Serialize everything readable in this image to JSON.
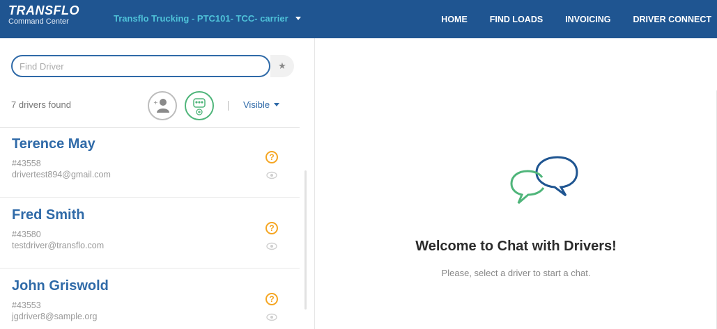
{
  "header": {
    "brand_name": "TRANSFLO",
    "brand_sub": "Command Center",
    "account_label": "Transflo Trucking - PTC101- TCC- carrier",
    "nav": [
      "HOME",
      "FIND LOADS",
      "INVOICING",
      "DRIVER CONNECT"
    ]
  },
  "search": {
    "placeholder": "Find Driver",
    "value": ""
  },
  "filters": {
    "count_text": "7 drivers found",
    "visibility_label": "Visible"
  },
  "drivers": [
    {
      "name": "Terence May",
      "id": "#43558",
      "email": "drivertest894@gmail.com"
    },
    {
      "name": "Fred Smith",
      "id": "#43580",
      "email": "testdriver@transflo.com"
    },
    {
      "name": "John Griswold",
      "id": "#43553",
      "email": "jgdriver8@sample.org"
    }
  ],
  "welcome": {
    "title": "Welcome to Chat with Drivers!",
    "subtitle": "Please, select a driver to start a chat."
  },
  "colors": {
    "header_bg": "#1f5591",
    "accent_blue": "#2f6aa8",
    "account_cyan": "#4fc3d9",
    "warning": "#f5a623",
    "green": "#4fb57a"
  },
  "icons": {
    "star": "star-icon",
    "add_driver": "add-driver-icon",
    "add_group": "add-group-icon",
    "status": "question-icon",
    "visibility": "eye-icon",
    "chat": "chat-bubbles-icon"
  }
}
